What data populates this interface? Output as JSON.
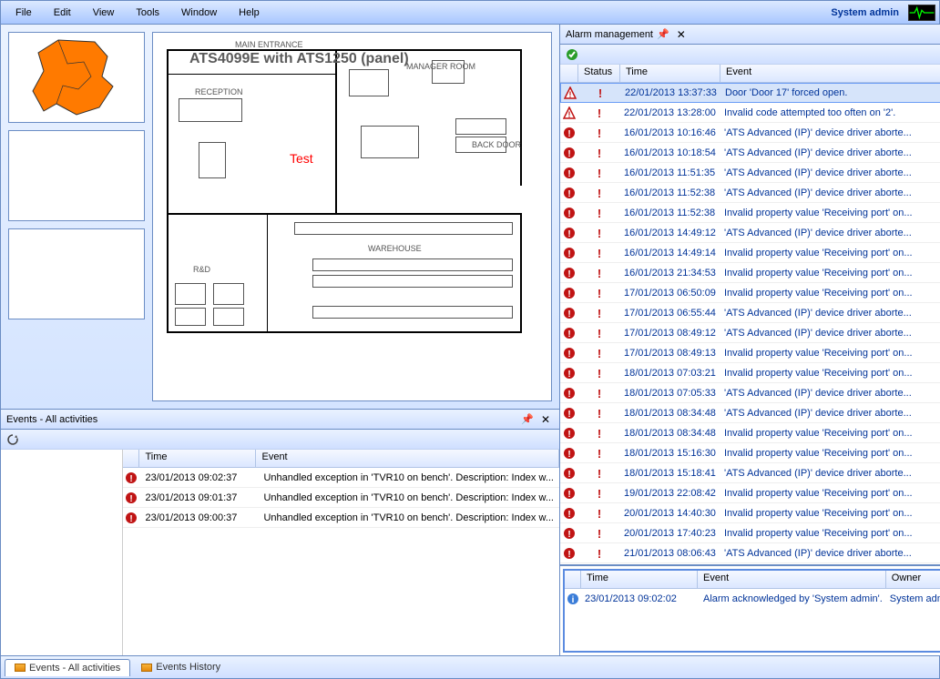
{
  "menu": {
    "file": "File",
    "edit": "Edit",
    "view": "View",
    "tools": "Tools",
    "window": "Window",
    "help": "Help"
  },
  "user_label": "System admin",
  "plan": {
    "title": "ATS4099E with ATS1250 (panel)",
    "test_label": "Test",
    "labels": {
      "main_entrance": "MAIN ENTRANCE",
      "reception": "RECEPTION",
      "manager": "MANAGER ROOM",
      "back_door": "BACK DOOR",
      "warehouse": "WAREHOUSE",
      "rd": "R&D"
    }
  },
  "events_panel": {
    "title": "Events - All activities",
    "headers": {
      "time": "Time",
      "event": "Event"
    },
    "rows": [
      {
        "time": "23/01/2013 09:02:37",
        "event": "Unhandled exception in 'TVR10 on bench'. Description: Index w..."
      },
      {
        "time": "23/01/2013 09:01:37",
        "event": "Unhandled exception in 'TVR10 on bench'. Description: Index w..."
      },
      {
        "time": "23/01/2013 09:00:37",
        "event": "Unhandled exception in 'TVR10 on bench'. Description: Index w..."
      }
    ]
  },
  "alarm_panel": {
    "title": "Alarm management",
    "headers": {
      "status": "Status",
      "time": "Time",
      "event": "Event"
    },
    "rows": [
      {
        "t": "warn",
        "sel": true,
        "time": "22/01/2013 13:37:33",
        "event": "Door 'Door 17' forced open."
      },
      {
        "t": "warn",
        "time": "22/01/2013 13:28:00",
        "event": "Invalid code attempted too often on '2'."
      },
      {
        "t": "err",
        "time": "16/01/2013 10:16:46",
        "event": "'ATS Advanced (IP)' device driver aborte..."
      },
      {
        "t": "err",
        "time": "16/01/2013 10:18:54",
        "event": "'ATS Advanced (IP)' device driver aborte..."
      },
      {
        "t": "err",
        "time": "16/01/2013 11:51:35",
        "event": "'ATS Advanced (IP)' device driver aborte..."
      },
      {
        "t": "err",
        "time": "16/01/2013 11:52:38",
        "event": "'ATS Advanced (IP)' device driver aborte..."
      },
      {
        "t": "err",
        "time": "16/01/2013 11:52:38",
        "event": "Invalid property value  'Receiving port' on..."
      },
      {
        "t": "err",
        "time": "16/01/2013 14:49:12",
        "event": "'ATS Advanced (IP)' device driver aborte..."
      },
      {
        "t": "err",
        "time": "16/01/2013 14:49:14",
        "event": "Invalid property value  'Receiving port' on..."
      },
      {
        "t": "err",
        "time": "16/01/2013 21:34:53",
        "event": "Invalid property value  'Receiving port' on..."
      },
      {
        "t": "err",
        "time": "17/01/2013 06:50:09",
        "event": "Invalid property value  'Receiving port' on..."
      },
      {
        "t": "err",
        "time": "17/01/2013 06:55:44",
        "event": "'ATS Advanced (IP)' device driver aborte..."
      },
      {
        "t": "err",
        "time": "17/01/2013 08:49:12",
        "event": "'ATS Advanced (IP)' device driver aborte..."
      },
      {
        "t": "err",
        "time": "17/01/2013 08:49:13",
        "event": "Invalid property value  'Receiving port' on..."
      },
      {
        "t": "err",
        "time": "18/01/2013 07:03:21",
        "event": "Invalid property value  'Receiving port' on..."
      },
      {
        "t": "err",
        "time": "18/01/2013 07:05:33",
        "event": "'ATS Advanced (IP)' device driver aborte..."
      },
      {
        "t": "err",
        "time": "18/01/2013 08:34:48",
        "event": "'ATS Advanced (IP)' device driver aborte..."
      },
      {
        "t": "err",
        "time": "18/01/2013 08:34:48",
        "event": "Invalid property value  'Receiving port' on..."
      },
      {
        "t": "err",
        "time": "18/01/2013 15:16:30",
        "event": "Invalid property value  'Receiving port' on..."
      },
      {
        "t": "err",
        "time": "18/01/2013 15:18:41",
        "event": "'ATS Advanced (IP)' device driver aborte..."
      },
      {
        "t": "err",
        "time": "19/01/2013 22:08:42",
        "event": "Invalid property value  'Receiving port' on..."
      },
      {
        "t": "err",
        "time": "20/01/2013 14:40:30",
        "event": "Invalid property value  'Receiving port' on..."
      },
      {
        "t": "err",
        "time": "20/01/2013 17:40:23",
        "event": "Invalid property value  'Receiving port' on..."
      },
      {
        "t": "err",
        "time": "21/01/2013 08:06:43",
        "event": "'ATS Advanced (IP)' device driver aborte..."
      }
    ],
    "ack": {
      "headers": {
        "time": "Time",
        "event": "Event",
        "owner": "Owner"
      },
      "row": {
        "time": "23/01/2013 09:02:02",
        "event": "Alarm acknowledged by 'System admin'.",
        "owner": "System admin"
      }
    }
  },
  "tabs": {
    "all": "Events - All activities",
    "history": "Events History"
  }
}
